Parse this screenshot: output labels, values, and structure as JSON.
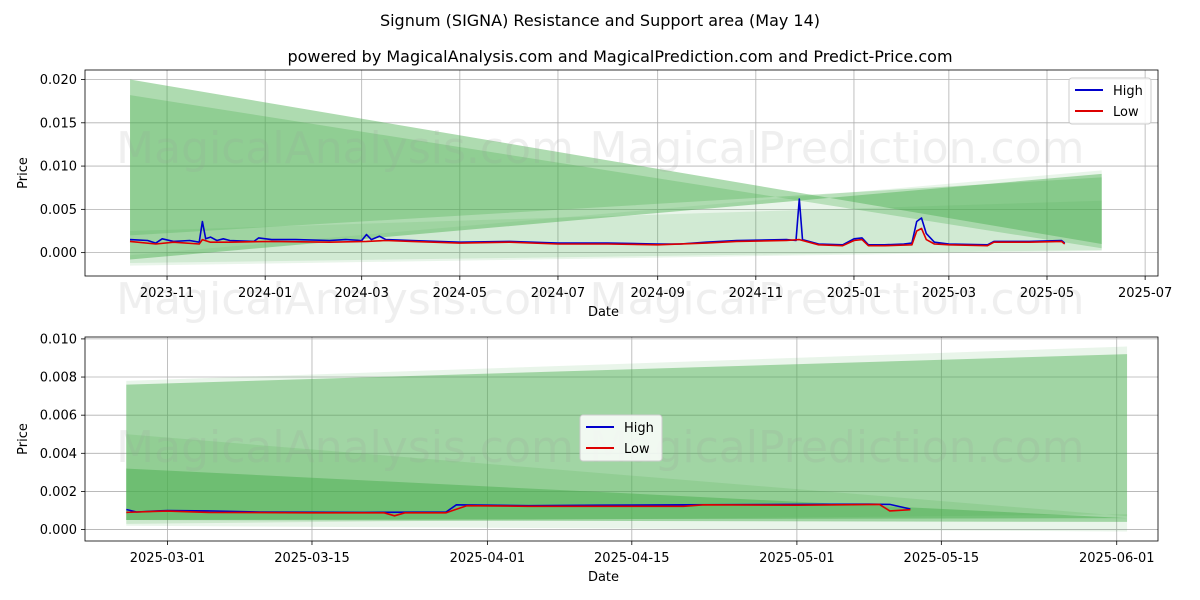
{
  "title": "Signum (SIGNA) Resistance and Support area (May 14)",
  "subtitle": "powered by MagicalAnalysis.com and MagicalPrediction.com and Predict-Price.com",
  "watermark": {
    "left": "MagicalAnalysis.com",
    "right": "MagicalPrediction.com"
  },
  "colors": {
    "high": "#0000cc",
    "low": "#dd0000",
    "band": "#4caf50",
    "grid": "#b0b0b0"
  },
  "chart_data": [
    {
      "type": "line",
      "xlabel": "Date",
      "ylabel": "Price",
      "x_ticks": [
        "2023-11",
        "2024-01",
        "2024-03",
        "2024-05",
        "2024-07",
        "2024-09",
        "2024-11",
        "2025-01",
        "2025-03",
        "2025-05",
        "2025-07"
      ],
      "y_ticks": [
        "0.000",
        "0.005",
        "0.010",
        "0.015",
        "0.020"
      ],
      "xlim": [
        "2023-09-11",
        "2025-07-09"
      ],
      "ylim": [
        -0.0027,
        0.0211
      ],
      "grid": true,
      "legend": "top-right",
      "bands": [
        {
          "x": [
            "2023-10-09",
            "2025-06-04"
          ],
          "upper": [
            0.02,
            0.001
          ],
          "lower": [
            -0.0008,
            0.0091
          ],
          "opacity": 0.45
        },
        {
          "x": [
            "2023-10-09",
            "2025-06-04"
          ],
          "upper": [
            0.0182,
            0.0005
          ],
          "lower": [
            0.002,
            0.0087
          ],
          "opacity": 0.3
        },
        {
          "x": [
            "2023-10-09",
            "2025-06-04"
          ],
          "upper": [
            0.0025,
            0.006
          ],
          "lower": [
            -0.0012,
            0.0003
          ],
          "opacity": 0.15
        },
        {
          "x": [
            "2023-10-09",
            "2025-06-04"
          ],
          "upper": [
            -0.0003,
            0.0095
          ],
          "lower": [
            -0.0015,
            0.0002
          ],
          "opacity": 0.12
        }
      ],
      "series": [
        {
          "name": "High",
          "color": "#0000cc",
          "points": [
            [
              "2023-10-09",
              0.0015
            ],
            [
              "2023-10-20",
              0.0014
            ],
            [
              "2023-10-25",
              0.0011
            ],
            [
              "2023-10-29",
              0.0016
            ],
            [
              "2023-11-05",
              0.0013
            ],
            [
              "2023-11-15",
              0.0014
            ],
            [
              "2023-11-21",
              0.0012
            ],
            [
              "2023-11-23",
              0.0036
            ],
            [
              "2023-11-25",
              0.0016
            ],
            [
              "2023-11-28",
              0.0018
            ],
            [
              "2023-12-02",
              0.0014
            ],
            [
              "2023-12-06",
              0.0016
            ],
            [
              "2023-12-10",
              0.0014
            ],
            [
              "2023-12-25",
              0.0013
            ],
            [
              "2023-12-28",
              0.0017
            ],
            [
              "2024-01-05",
              0.0015
            ],
            [
              "2024-01-20",
              0.0015
            ],
            [
              "2024-02-10",
              0.0014
            ],
            [
              "2024-02-20",
              0.0015
            ],
            [
              "2024-03-01",
              0.0014
            ],
            [
              "2024-03-04",
              0.0021
            ],
            [
              "2024-03-07",
              0.0015
            ],
            [
              "2024-03-12",
              0.0019
            ],
            [
              "2024-03-16",
              0.0015
            ],
            [
              "2024-04-01",
              0.0014
            ],
            [
              "2024-05-01",
              0.0012
            ],
            [
              "2024-06-01",
              0.0013
            ],
            [
              "2024-07-01",
              0.0011
            ],
            [
              "2024-08-01",
              0.0011
            ],
            [
              "2024-09-01",
              0.001
            ],
            [
              "2024-09-15",
              0.001
            ],
            [
              "2024-10-01",
              0.0012
            ],
            [
              "2024-10-20",
              0.0014
            ],
            [
              "2024-11-20",
              0.0015
            ],
            [
              "2024-11-26",
              0.0014
            ],
            [
              "2024-11-28",
              0.0062
            ],
            [
              "2024-11-30",
              0.0015
            ],
            [
              "2024-12-10",
              0.001
            ],
            [
              "2024-12-25",
              0.0009
            ],
            [
              "2025-01-01",
              0.0016
            ],
            [
              "2025-01-06",
              0.0017
            ],
            [
              "2025-01-10",
              0.0009
            ],
            [
              "2025-01-20",
              0.0009
            ],
            [
              "2025-02-01",
              0.001
            ],
            [
              "2025-02-06",
              0.0011
            ],
            [
              "2025-02-09",
              0.0036
            ],
            [
              "2025-02-12",
              0.004
            ],
            [
              "2025-02-15",
              0.0022
            ],
            [
              "2025-02-20",
              0.0012
            ],
            [
              "2025-03-01",
              0.001
            ],
            [
              "2025-03-25",
              0.0009
            ],
            [
              "2025-03-29",
              0.0013
            ],
            [
              "2025-04-20",
              0.0013
            ],
            [
              "2025-05-10",
              0.0014
            ],
            [
              "2025-05-12",
              0.0011
            ]
          ]
        },
        {
          "name": "Low",
          "color": "#dd0000",
          "points": [
            [
              "2023-10-09",
              0.0013
            ],
            [
              "2023-10-25",
              0.001
            ],
            [
              "2023-11-05",
              0.0012
            ],
            [
              "2023-11-21",
              0.001
            ],
            [
              "2023-11-23",
              0.0015
            ],
            [
              "2023-11-28",
              0.0012
            ],
            [
              "2023-12-10",
              0.0012
            ],
            [
              "2024-01-05",
              0.0013
            ],
            [
              "2024-02-10",
              0.0012
            ],
            [
              "2024-03-04",
              0.0013
            ],
            [
              "2024-03-16",
              0.0014
            ],
            [
              "2024-04-01",
              0.0013
            ],
            [
              "2024-05-01",
              0.0011
            ],
            [
              "2024-06-01",
              0.0012
            ],
            [
              "2024-07-01",
              0.001
            ],
            [
              "2024-08-01",
              0.001
            ],
            [
              "2024-09-01",
              0.0009
            ],
            [
              "2024-10-01",
              0.0011
            ],
            [
              "2024-10-20",
              0.0013
            ],
            [
              "2024-11-20",
              0.0014
            ],
            [
              "2024-11-28",
              0.0015
            ],
            [
              "2024-12-10",
              0.0009
            ],
            [
              "2024-12-25",
              0.0008
            ],
            [
              "2025-01-01",
              0.0014
            ],
            [
              "2025-01-06",
              0.0015
            ],
            [
              "2025-01-10",
              0.0008
            ],
            [
              "2025-01-20",
              0.0008
            ],
            [
              "2025-02-06",
              0.0009
            ],
            [
              "2025-02-09",
              0.0025
            ],
            [
              "2025-02-12",
              0.0028
            ],
            [
              "2025-02-15",
              0.0015
            ],
            [
              "2025-02-20",
              0.001
            ],
            [
              "2025-03-01",
              0.0009
            ],
            [
              "2025-03-25",
              0.0008
            ],
            [
              "2025-03-29",
              0.0012
            ],
            [
              "2025-04-20",
              0.0012
            ],
            [
              "2025-05-10",
              0.0013
            ],
            [
              "2025-05-12",
              0.001
            ]
          ]
        }
      ]
    },
    {
      "type": "line",
      "xlabel": "Date",
      "ylabel": "Price",
      "x_ticks": [
        "2025-03-01",
        "2025-03-15",
        "2025-04-01",
        "2025-04-15",
        "2025-05-01",
        "2025-05-15",
        "2025-06-01"
      ],
      "y_ticks": [
        "0.000",
        "0.002",
        "0.004",
        "0.006",
        "0.008",
        "0.010"
      ],
      "xlim": [
        "2025-02-21",
        "2025-06-05"
      ],
      "ylim": [
        -0.0006,
        0.0101
      ],
      "grid": true,
      "legend": "center",
      "bands": [
        {
          "x": [
            "2025-02-25",
            "2025-06-02"
          ],
          "upper": [
            0.0076,
            0.0092
          ],
          "lower": [
            0.0005,
            0.0004
          ],
          "opacity": 0.45
        },
        {
          "x": [
            "2025-02-25",
            "2025-06-02"
          ],
          "upper": [
            0.0032,
            0.0006
          ],
          "lower": [
            0.0005,
            0.0006
          ],
          "opacity": 0.5
        },
        {
          "x": [
            "2025-02-25",
            "2025-06-02"
          ],
          "upper": [
            0.005,
            0.0007
          ],
          "lower": [
            0.0003,
            0.0008
          ],
          "opacity": 0.18
        },
        {
          "x": [
            "2025-02-25",
            "2025-06-02"
          ],
          "upper": [
            0.0078,
            0.0096
          ],
          "lower": [
            0.0002,
            -0.0001
          ],
          "opacity": 0.12
        }
      ],
      "series": [
        {
          "name": "High",
          "color": "#0000cc",
          "points": [
            [
              "2025-02-25",
              0.00105
            ],
            [
              "2025-02-26",
              0.00092
            ],
            [
              "2025-02-28",
              0.00098
            ],
            [
              "2025-03-01",
              0.001
            ],
            [
              "2025-03-05",
              0.00098
            ],
            [
              "2025-03-10",
              0.00092
            ],
            [
              "2025-03-20",
              0.0009
            ],
            [
              "2025-03-28",
              0.00092
            ],
            [
              "2025-03-29",
              0.0013
            ],
            [
              "2025-04-05",
              0.00125
            ],
            [
              "2025-04-12",
              0.00128
            ],
            [
              "2025-04-20",
              0.0013
            ],
            [
              "2025-04-30",
              0.00132
            ],
            [
              "2025-05-08",
              0.00133
            ],
            [
              "2025-05-10",
              0.00132
            ],
            [
              "2025-05-12",
              0.00108
            ]
          ]
        },
        {
          "name": "Low",
          "color": "#dd0000",
          "points": [
            [
              "2025-02-25",
              0.0009
            ],
            [
              "2025-02-28",
              0.00096
            ],
            [
              "2025-03-01",
              0.00097
            ],
            [
              "2025-03-05",
              0.0009
            ],
            [
              "2025-03-15",
              0.00088
            ],
            [
              "2025-03-22",
              0.00088
            ],
            [
              "2025-03-23",
              0.00072
            ],
            [
              "2025-03-24",
              0.00088
            ],
            [
              "2025-03-28",
              0.00088
            ],
            [
              "2025-03-30",
              0.00125
            ],
            [
              "2025-04-05",
              0.00122
            ],
            [
              "2025-04-20",
              0.00122
            ],
            [
              "2025-04-22",
              0.0013
            ],
            [
              "2025-05-01",
              0.00128
            ],
            [
              "2025-05-09",
              0.00132
            ],
            [
              "2025-05-10",
              0.00098
            ],
            [
              "2025-05-12",
              0.00104
            ]
          ]
        }
      ]
    }
  ]
}
